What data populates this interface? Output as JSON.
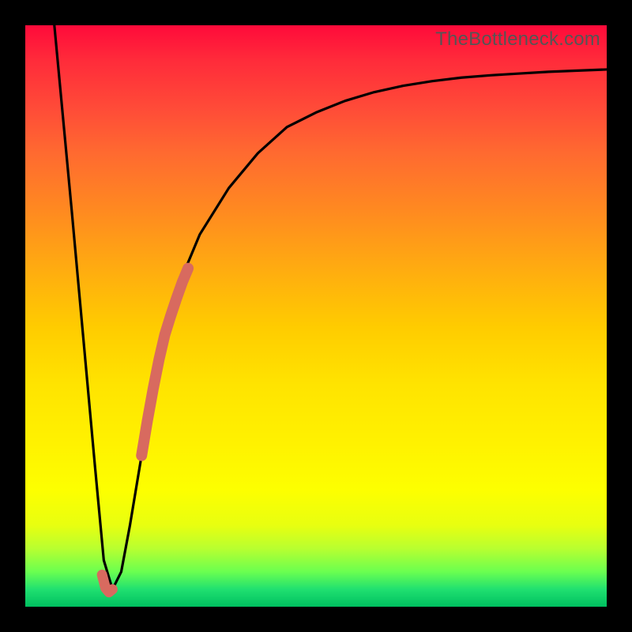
{
  "watermark": "TheBottleneck.com",
  "colors": {
    "curve": "#000000",
    "highlight": "#d86a5f",
    "frame": "#000000"
  },
  "chart_data": {
    "type": "line",
    "title": "",
    "xlabel": "",
    "ylabel": "",
    "xlim": [
      0,
      100
    ],
    "ylim": [
      0,
      100
    ],
    "grid": false,
    "legend": false,
    "series": [
      {
        "name": "bottleneck-curve",
        "x": [
          5,
          8,
          10,
          12,
          13.5,
          15,
          16.5,
          18,
          20,
          22.5,
          25,
          27.5,
          30,
          35,
          40,
          45,
          50,
          55,
          60,
          65,
          70,
          75,
          80,
          85,
          90,
          95,
          100
        ],
        "y": [
          100,
          68,
          46,
          24,
          8,
          3,
          6,
          14,
          26,
          40,
          50,
          58,
          64,
          72,
          78,
          82.5,
          85,
          87,
          88.5,
          89.6,
          90.4,
          91,
          91.4,
          91.7,
          92,
          92.2,
          92.4
        ]
      }
    ],
    "highlights": [
      {
        "name": "bottom-hook",
        "x": [
          13.2,
          13.8,
          14.4,
          15.0
        ],
        "y": [
          5.5,
          3.2,
          2.5,
          3.0
        ]
      },
      {
        "name": "right-rising-segment",
        "x": [
          20.0,
          21.0,
          22.0,
          23.0,
          24.0,
          25.0,
          26.0,
          27.0,
          28.0
        ],
        "y": [
          26.0,
          32.0,
          37.5,
          42.5,
          46.8,
          50.0,
          53.0,
          55.8,
          58.2
        ]
      }
    ]
  }
}
